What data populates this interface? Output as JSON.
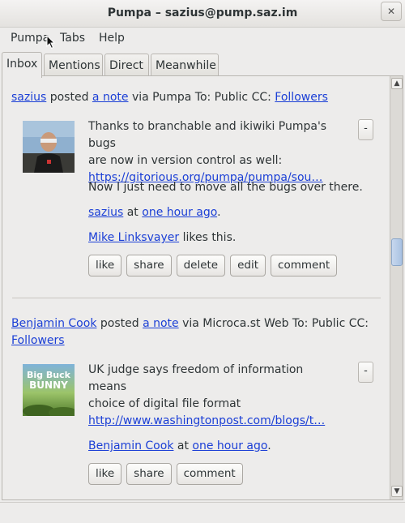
{
  "window": {
    "title": "Pumpa – sazius@pump.saz.im",
    "close_glyph": "✕"
  },
  "menubar": {
    "items": [
      {
        "label": "Pumpa"
      },
      {
        "label": "Tabs"
      },
      {
        "label": "Help"
      }
    ]
  },
  "tabs": [
    {
      "label": "Inbox",
      "active": true
    },
    {
      "label": "Mentions",
      "active": false
    },
    {
      "label": "Direct",
      "active": false
    },
    {
      "label": "Meanwhile",
      "active": false
    }
  ],
  "posts": [
    {
      "author": "sazius",
      "posted_text": " posted ",
      "object": "a note",
      "via_text": " via Pumpa To: Public CC: ",
      "cc_link": "Followers",
      "collapse_label": "-",
      "body_lines": [
        "Thanks to branchable and ikiwiki Pumpa's bugs",
        "are now in version control as well:"
      ],
      "url": "https://gitorious.org/pumpa/pumpa/sou…",
      "body_extra": "Now I just need to move all the bugs over there.",
      "footer_author": "sazius",
      "footer_at": " at ",
      "footer_time": "one hour ago",
      "footer_dot": ".",
      "liked_by": "Mike Linksvayer",
      "likes_text": " likes this.",
      "buttons": [
        "like",
        "share",
        "delete",
        "edit",
        "comment"
      ]
    },
    {
      "author": "Benjamin Cook",
      "posted_text": " posted ",
      "object": "a note",
      "via_text": " via Microca.st Web To: Public CC: ",
      "cc_link": "Followers",
      "collapse_label": "-",
      "body_lines": [
        "UK judge says freedom of information means",
        "choice of digital file format"
      ],
      "url": "http://www.washingtonpost.com/blogs/t…",
      "footer_author": "Benjamin Cook",
      "footer_at": " at ",
      "footer_time": "one hour ago",
      "footer_dot": ".",
      "buttons": [
        "like",
        "share",
        "comment"
      ]
    }
  ],
  "avatar2_text": [
    "Big Buck",
    "BUNNY"
  ],
  "scrollbar": {
    "up_glyph": "▲",
    "down_glyph": "▼"
  },
  "colors": {
    "link": "#1b3fd6",
    "background": "#edeceb"
  }
}
